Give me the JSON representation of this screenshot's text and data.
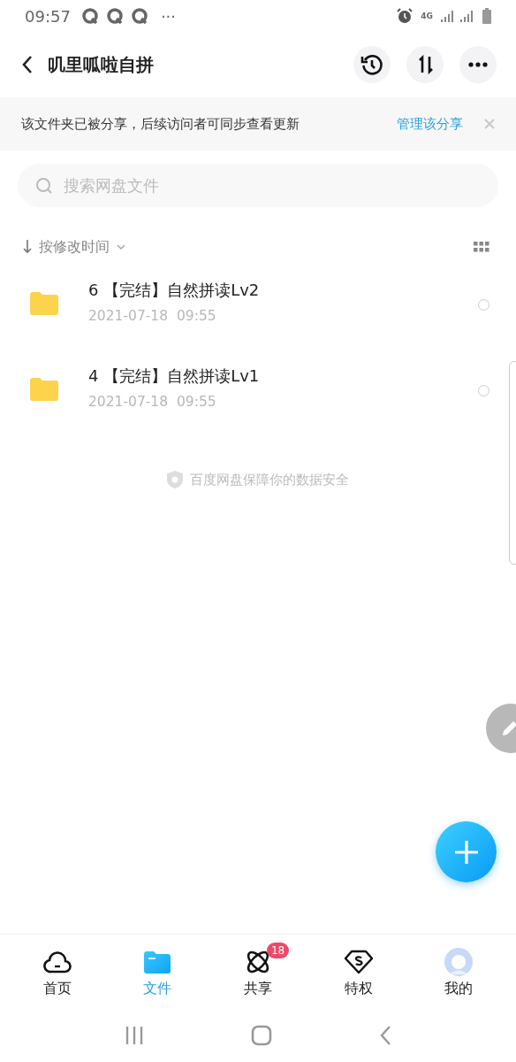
{
  "status_bar": {
    "time": "09:57",
    "overflow": "···",
    "network": "4G"
  },
  "header": {
    "title": "叽里呱啦自拼"
  },
  "share_banner": {
    "message": "该文件夹已被分享，后续访问者可同步查看更新",
    "action": "管理该分享"
  },
  "search": {
    "placeholder": "搜索网盘文件"
  },
  "sort": {
    "label": "按修改时间"
  },
  "files": [
    {
      "name": "6 【完结】自然拼读Lv2",
      "modified": "2021-07-18  09:55",
      "selected": false
    },
    {
      "name": "4 【完结】自然拼读Lv1",
      "modified": "2021-07-18  09:55",
      "selected": false
    }
  ],
  "footer_note": "百度网盘保障你的数据安全",
  "bottom_nav": [
    {
      "kind": "home",
      "label": "首页",
      "selected": false
    },
    {
      "kind": "files",
      "label": "文件",
      "selected": true
    },
    {
      "kind": "share",
      "label": "共享",
      "selected": false,
      "badge": "18"
    },
    {
      "kind": "vip",
      "label": "特权",
      "selected": false
    },
    {
      "kind": "me",
      "label": "我的",
      "selected": false
    }
  ]
}
